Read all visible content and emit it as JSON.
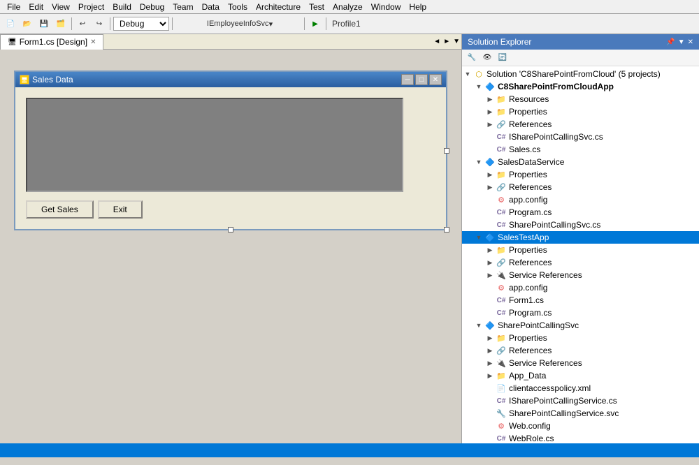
{
  "menubar": {
    "items": [
      "File",
      "Edit",
      "View",
      "Project",
      "Build",
      "Debug",
      "Team",
      "Data",
      "Tools",
      "Architecture",
      "Test",
      "Analyze",
      "Window",
      "Help"
    ]
  },
  "toolbar": {
    "debug_config": "Debug",
    "target": "IEmployeeInfoSvc",
    "profile_label": "Profile1"
  },
  "tab": {
    "label": "Form1.cs [Design]"
  },
  "form_window": {
    "title": "Sales Data",
    "buttons": {
      "get_sales": "Get Sales",
      "exit": "Exit"
    },
    "minimize": "─",
    "maximize": "□",
    "close": "✕"
  },
  "solution_explorer": {
    "title": "Solution Explorer",
    "solution": {
      "label": "Solution 'C8SharePointFromCloud' (5 projects)"
    },
    "projects": [
      {
        "name": "C8SharePointFromCloudApp",
        "expanded": true,
        "children": [
          {
            "type": "folder",
            "name": "Resources",
            "expanded": false
          },
          {
            "type": "folder",
            "name": "Properties",
            "expanded": false
          },
          {
            "type": "ref",
            "name": "References",
            "expanded": false
          },
          {
            "type": "cs",
            "name": "ISharePointCallingSvc.cs"
          },
          {
            "type": "cs",
            "name": "Sales.cs"
          }
        ]
      },
      {
        "name": "SalesDataService",
        "expanded": true,
        "children": [
          {
            "type": "folder",
            "name": "Properties",
            "expanded": false
          },
          {
            "type": "ref",
            "name": "References",
            "expanded": false
          },
          {
            "type": "config",
            "name": "app.config"
          },
          {
            "type": "cs",
            "name": "Program.cs"
          },
          {
            "type": "cs",
            "name": "SharePointCallingSvc.cs"
          }
        ]
      },
      {
        "name": "SalesTestApp",
        "expanded": true,
        "selected": true,
        "children": [
          {
            "type": "folder",
            "name": "Properties",
            "expanded": false
          },
          {
            "type": "ref",
            "name": "References",
            "expanded": false
          },
          {
            "type": "svcref",
            "name": "Service References",
            "expanded": false
          },
          {
            "type": "config",
            "name": "app.config"
          },
          {
            "type": "cs",
            "name": "Form1.cs"
          },
          {
            "type": "cs",
            "name": "Program.cs"
          }
        ]
      },
      {
        "name": "SharePointCallingSvc",
        "expanded": true,
        "children": [
          {
            "type": "folder",
            "name": "Properties",
            "expanded": false
          },
          {
            "type": "ref",
            "name": "References",
            "expanded": false
          },
          {
            "type": "svcref",
            "name": "Service References",
            "expanded": false
          },
          {
            "type": "folder",
            "name": "App_Data",
            "expanded": false
          },
          {
            "type": "xml",
            "name": "clientaccesspolicy.xml"
          },
          {
            "type": "cs",
            "name": "ISharePointCallingService.cs"
          },
          {
            "type": "svc",
            "name": "SharePointCallingService.svc"
          },
          {
            "type": "config",
            "name": "Web.config"
          },
          {
            "type": "cs",
            "name": "WebRole.cs"
          }
        ]
      }
    ]
  },
  "status_bar": {
    "text": ""
  }
}
